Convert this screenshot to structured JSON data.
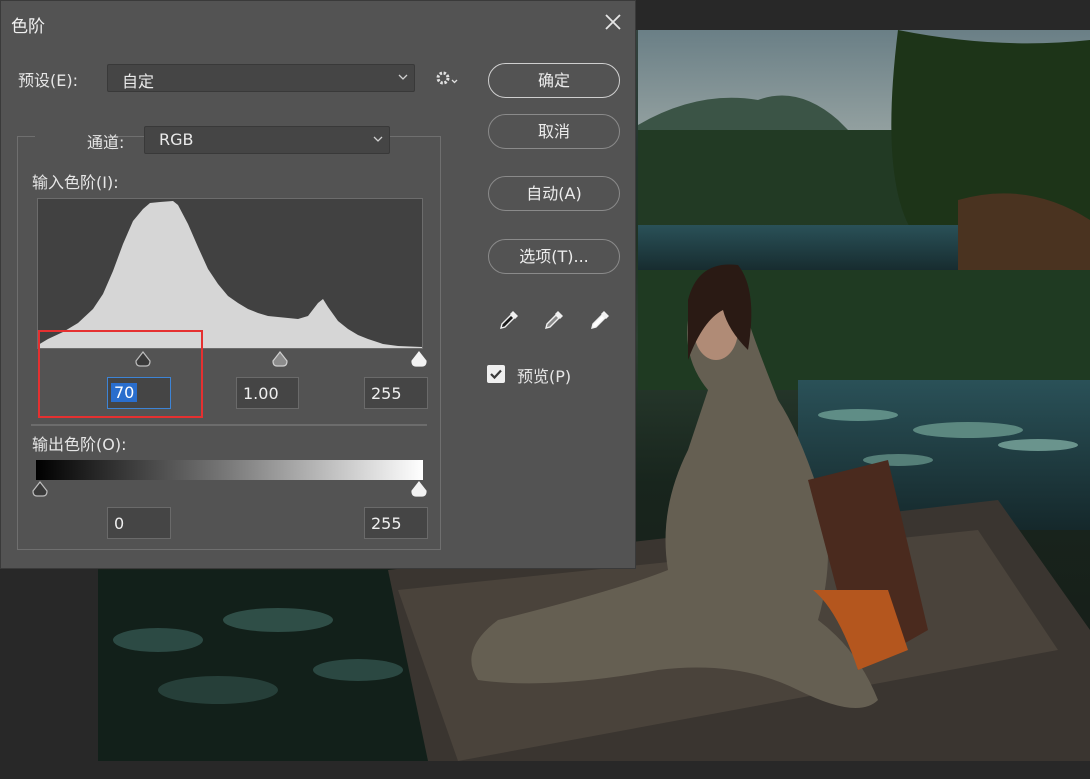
{
  "dialog": {
    "title": "色阶",
    "close_icon": "close-icon",
    "preset": {
      "label": "预设(E):",
      "value": "自定"
    },
    "channel": {
      "label": "通道:",
      "value": "RGB"
    },
    "input_levels": {
      "label": "输入色阶(I):",
      "shadow": "70",
      "midtone": "1.00",
      "highlight": "255"
    },
    "output_levels": {
      "label": "输出色阶(O):",
      "low": "0",
      "high": "255"
    },
    "buttons": {
      "ok": "确定",
      "cancel": "取消",
      "auto": "自动(A)",
      "options": "选项(T)..."
    },
    "preview": {
      "label": "预览(P)",
      "checked": true
    },
    "eyedroppers": [
      "black-point-eyedropper-icon",
      "gray-point-eyedropper-icon",
      "white-point-eyedropper-icon"
    ]
  },
  "colors": {
    "dialog_bg": "#535353",
    "field_bg": "#454545",
    "focus_blue": "#2a6ecd",
    "annotation_red": "#e53030"
  }
}
